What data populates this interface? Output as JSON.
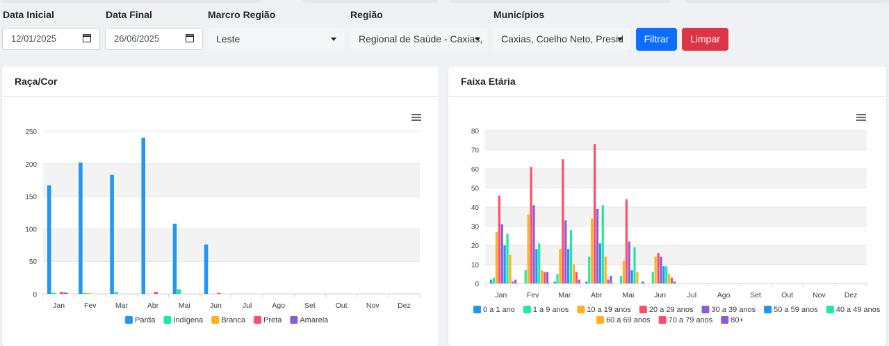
{
  "filters": {
    "data_inicial": {
      "label": "Data Inicial",
      "value": "12/01/2025"
    },
    "data_final": {
      "label": "Data Final",
      "value": "26/06/2025"
    },
    "macro_regiao": {
      "label": "Marcro Região",
      "value": "Leste"
    },
    "regiao": {
      "label": "Região",
      "value": "Regional de Saúde - Caxias,"
    },
    "municipios": {
      "label": "Municípios",
      "value": "Caxias, Coelho Neto, Presid"
    },
    "filtrar_label": "Filtrar",
    "limpar_label": "Limpar"
  },
  "colors": {
    "primary": "#0d6efd",
    "danger": "#dc3545"
  },
  "cards": {
    "raca": {
      "title": "Raça/Cor"
    },
    "faixa": {
      "title": "Faixa Etária"
    }
  },
  "chart_data": [
    {
      "type": "bar",
      "title": "Raça/Cor",
      "categories": [
        "Jan",
        "Fev",
        "Mar",
        "Abr",
        "Mai",
        "Jun",
        "Jul",
        "Ago",
        "Set",
        "Out",
        "Nov",
        "Dez"
      ],
      "ylim": [
        0,
        250
      ],
      "yticks": [
        0,
        50,
        100,
        150,
        200,
        250
      ],
      "grid": true,
      "legend_position": "bottom",
      "series": [
        {
          "name": "Parda",
          "color": "#2196f3",
          "values": [
            167,
            202,
            183,
            240,
            108,
            76,
            0,
            0,
            0,
            0,
            0,
            0
          ]
        },
        {
          "name": "Indígena",
          "color": "#1de9a0",
          "values": [
            2,
            1,
            3,
            0,
            7,
            0,
            0,
            0,
            0,
            0,
            0,
            0
          ]
        },
        {
          "name": "Branca",
          "color": "#ffb020",
          "values": [
            0,
            1,
            0,
            0,
            0,
            0,
            0,
            0,
            0,
            0,
            0,
            0
          ]
        },
        {
          "name": "Preta",
          "color": "#ff4d6a",
          "values": [
            3,
            0,
            0,
            3,
            0,
            1,
            0,
            0,
            0,
            0,
            0,
            0
          ]
        },
        {
          "name": "Amarela",
          "color": "#8a5cd8",
          "values": [
            2,
            0,
            0,
            0,
            0,
            0,
            0,
            0,
            0,
            0,
            0,
            0
          ]
        }
      ]
    },
    {
      "type": "bar",
      "title": "Faixa Etária",
      "categories": [
        "Jan",
        "Fev",
        "Mar",
        "Abr",
        "Mai",
        "Jun",
        "Jul",
        "Ago",
        "Set",
        "Out",
        "Nov",
        "Dez"
      ],
      "ylim": [
        0,
        80
      ],
      "yticks": [
        0,
        10,
        20,
        30,
        40,
        50,
        60,
        70,
        80
      ],
      "grid": true,
      "legend_position": "bottom",
      "series": [
        {
          "name": "0 a 1 ano",
          "color": "#2196f3",
          "values": [
            2,
            0,
            1,
            1,
            0,
            0,
            0,
            0,
            0,
            0,
            0,
            0
          ]
        },
        {
          "name": "1 a 9 anos",
          "color": "#1de9a0",
          "values": [
            3,
            7,
            5,
            14,
            4,
            6,
            0,
            0,
            0,
            0,
            0,
            0
          ]
        },
        {
          "name": "10 a 19 anos",
          "color": "#ffb020",
          "values": [
            27,
            36,
            18,
            34,
            12,
            14,
            0,
            0,
            0,
            0,
            0,
            0
          ]
        },
        {
          "name": "20 a 29 anos",
          "color": "#ff4d6a",
          "values": [
            46,
            61,
            65,
            73,
            44,
            16,
            0,
            0,
            0,
            0,
            0,
            0
          ]
        },
        {
          "name": "30 a 39 anos",
          "color": "#8a5cd8",
          "values": [
            31,
            41,
            33,
            39,
            22,
            14,
            0,
            0,
            0,
            0,
            0,
            0
          ]
        },
        {
          "name": "50 a 59 anos",
          "color": "#2196f3",
          "values": [
            20,
            18,
            18,
            21,
            7,
            9,
            0,
            0,
            0,
            0,
            0,
            0
          ]
        },
        {
          "name": "40 a 49 anos",
          "color": "#1de9a0",
          "values": [
            26,
            21,
            28,
            41,
            19,
            9,
            0,
            0,
            0,
            0,
            0,
            0
          ]
        },
        {
          "name": "60 a 69 anos",
          "color": "#ffb020",
          "values": [
            15,
            7,
            10,
            14,
            6,
            5,
            0,
            0,
            0,
            0,
            0,
            0
          ]
        },
        {
          "name": "70 a 79 anos",
          "color": "#ff4d6a",
          "values": [
            1,
            6,
            6,
            2,
            0,
            3,
            0,
            0,
            0,
            0,
            0,
            0
          ]
        },
        {
          "name": "80+",
          "color": "#8a5cd8",
          "values": [
            2,
            6,
            2,
            4,
            1,
            1,
            0,
            0,
            0,
            0,
            0,
            0
          ]
        }
      ]
    }
  ]
}
